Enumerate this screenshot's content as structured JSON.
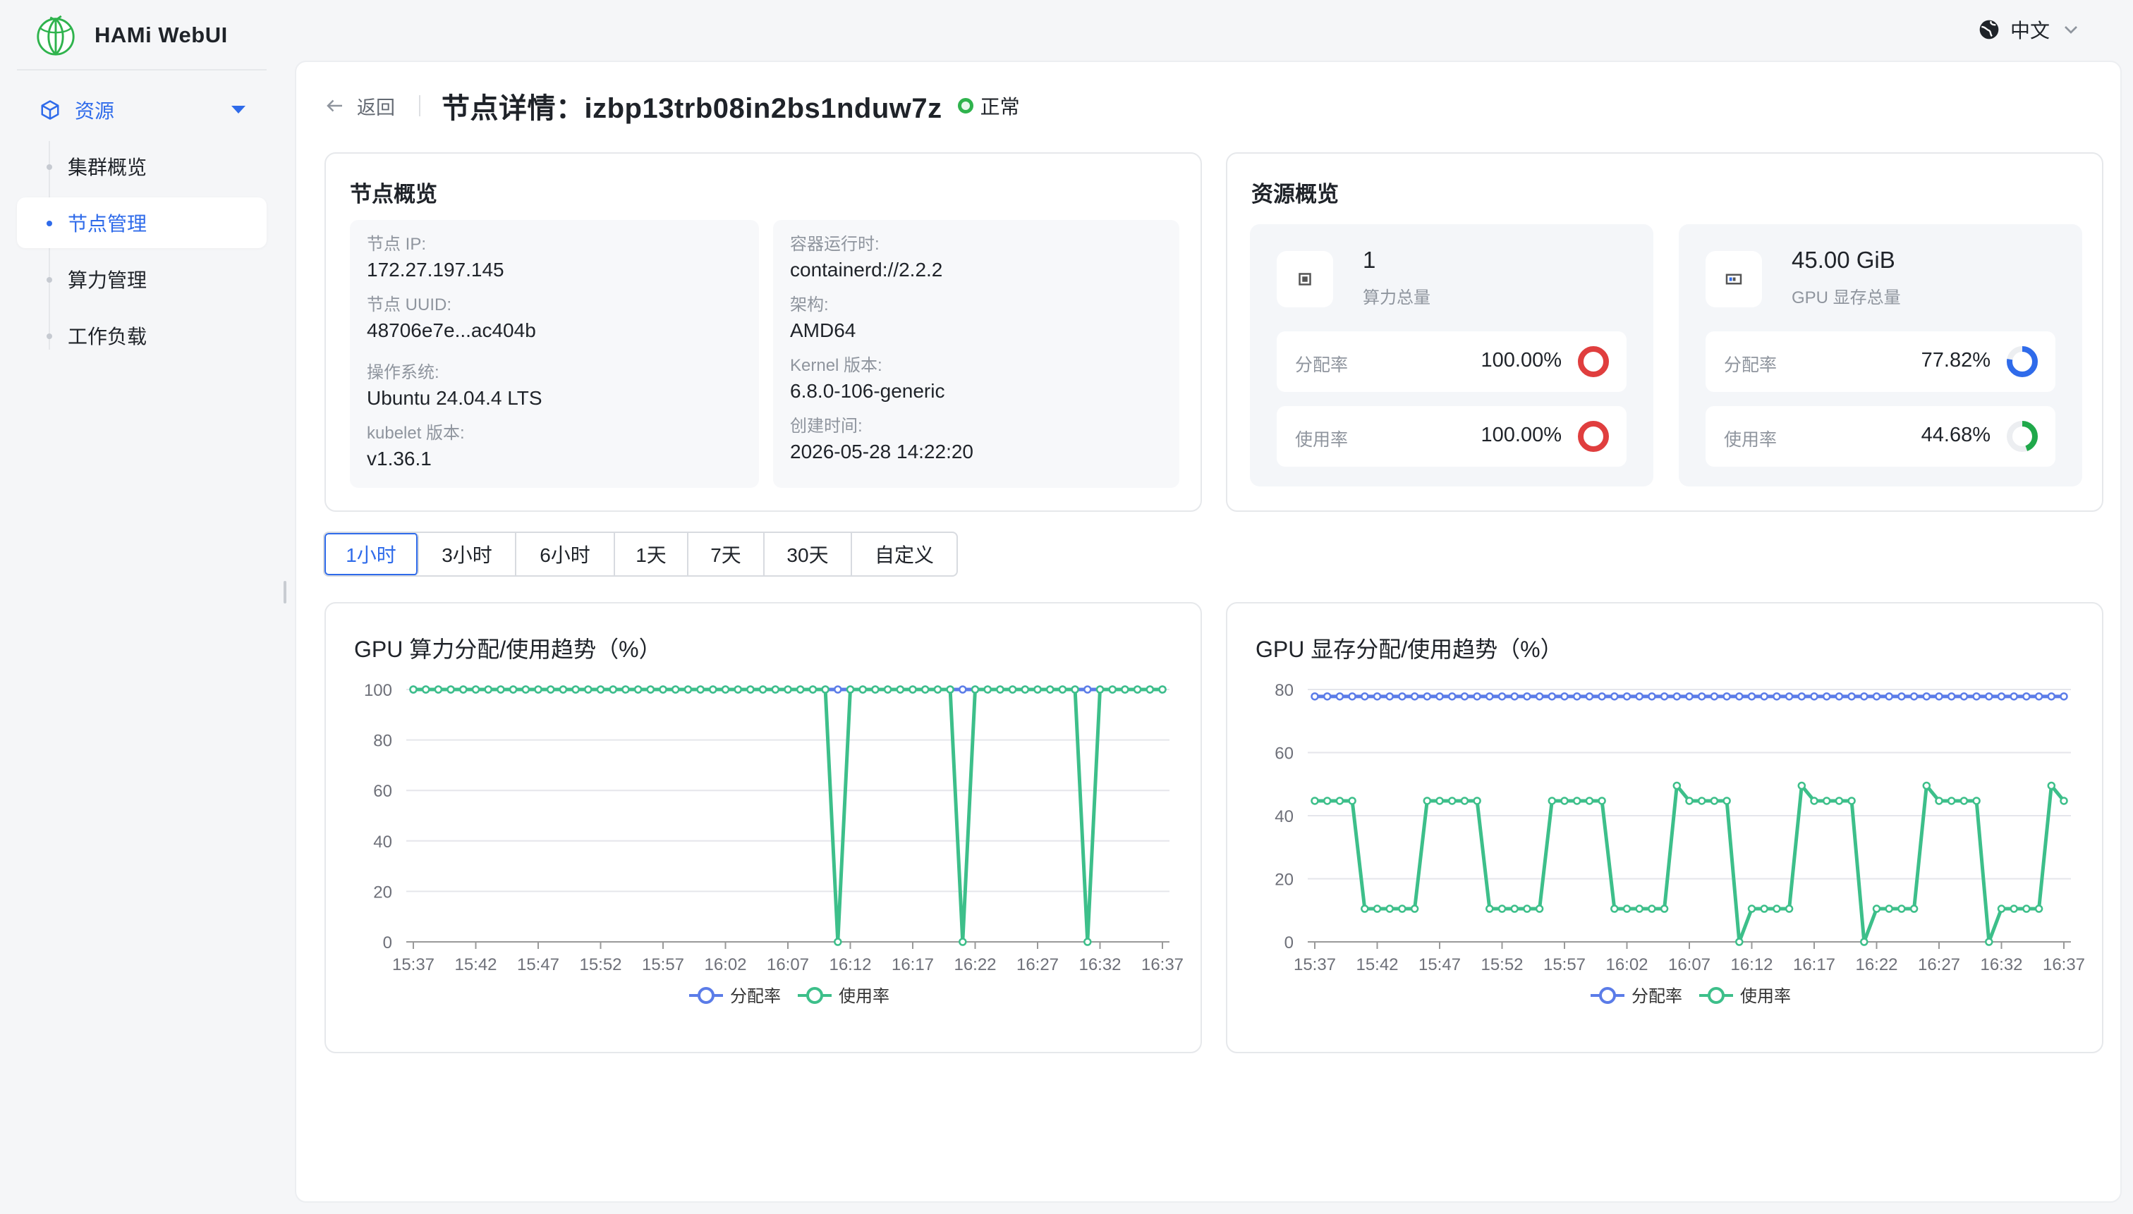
{
  "app": {
    "title": "HAMi WebUI"
  },
  "language": {
    "label": "中文"
  },
  "sidebar": {
    "group": {
      "label": "资源"
    },
    "items": [
      {
        "label": "集群概览",
        "active": false
      },
      {
        "label": "节点管理",
        "active": true
      },
      {
        "label": "算力管理",
        "active": false
      },
      {
        "label": "工作负载",
        "active": false
      }
    ]
  },
  "header": {
    "back_label": "返回",
    "title": "节点详情：izbp13trb08in2bs1nduw7z",
    "status": "正常"
  },
  "node_overview": {
    "title": "节点概览",
    "left": [
      {
        "label": "节点 IP:",
        "value": "172.27.197.145"
      },
      {
        "label": "节点 UUID:",
        "value": "48706e7e...ac404b"
      },
      {
        "label": "操作系统:",
        "value": "Ubuntu 24.04.4 LTS"
      },
      {
        "label": "kubelet 版本:",
        "value": "v1.36.1"
      }
    ],
    "right": [
      {
        "label": "容器运行时:",
        "value": "containerd://2.2.2"
      },
      {
        "label": "架构:",
        "value": "AMD64"
      },
      {
        "label": "Kernel 版本:",
        "value": "6.8.0-106-generic"
      },
      {
        "label": "创建时间:",
        "value": "2026-05-28 14:22:20"
      }
    ]
  },
  "resource_overview": {
    "title": "资源概览",
    "compute": {
      "value": "1",
      "caption": "算力总量",
      "icon": "chip-icon",
      "alloc_label": "分配率",
      "alloc_value": "100.00%",
      "alloc_fraction": 1.0,
      "usage_label": "使用率",
      "usage_value": "100.00%",
      "usage_fraction": 1.0,
      "color": "#e03e3e"
    },
    "memory": {
      "value": "45.00 GiB",
      "caption": "GPU 显存总量",
      "icon": "memory-icon",
      "alloc_label": "分配率",
      "alloc_value": "77.82%",
      "alloc_fraction": 0.7782,
      "alloc_color": "#2f6bea",
      "usage_label": "使用率",
      "usage_value": "44.68%",
      "usage_fraction": 0.4468,
      "usage_color": "#1fa84a"
    }
  },
  "time_ranges": {
    "options": [
      "1小时",
      "3小时",
      "6小时",
      "1天",
      "7天",
      "30天",
      "自定义"
    ],
    "selected": "1小时"
  },
  "charts": {
    "colors": {
      "alloc": "#5b7ce8",
      "usage": "#3dbf8a"
    },
    "legend": {
      "alloc": "分配率",
      "usage": "使用率"
    },
    "compute": {
      "title": "GPU 算力分配/使用趋势（%）"
    },
    "memory": {
      "title": "GPU 显存分配/使用趋势（%）"
    }
  },
  "chart_data": [
    {
      "type": "line",
      "title": "GPU 算力分配/使用趋势（%）",
      "x_ticks": [
        "15:37",
        "15:42",
        "15:47",
        "15:52",
        "15:57",
        "16:02",
        "16:07",
        "16:12",
        "16:17",
        "16:22",
        "16:27",
        "16:32",
        "16:37"
      ],
      "ylim": [
        0,
        100
      ],
      "y_ticks": [
        0,
        20,
        40,
        60,
        80,
        100
      ],
      "grid": true,
      "legend_position": "bottom",
      "series": [
        {
          "name": "分配率",
          "values": [
            100,
            100,
            100,
            100,
            100,
            100,
            100,
            100,
            100,
            100,
            100,
            100,
            100,
            100,
            100,
            100,
            100,
            100,
            100,
            100,
            100,
            100,
            100,
            100,
            100,
            100,
            100,
            100,
            100,
            100,
            100,
            100,
            100,
            100,
            100,
            100,
            100,
            100,
            100,
            100,
            100,
            100,
            100,
            100,
            100,
            100,
            100,
            100,
            100,
            100,
            100,
            100,
            100,
            100,
            100,
            100,
            100,
            100,
            100,
            100,
            100
          ]
        },
        {
          "name": "使用率",
          "values": [
            100,
            100,
            100,
            100,
            100,
            100,
            100,
            100,
            100,
            100,
            100,
            100,
            100,
            100,
            100,
            100,
            100,
            100,
            100,
            100,
            100,
            100,
            100,
            100,
            100,
            100,
            100,
            100,
            100,
            100,
            100,
            100,
            100,
            100,
            0,
            100,
            100,
            100,
            100,
            100,
            100,
            100,
            100,
            100,
            0,
            100,
            100,
            100,
            100,
            100,
            100,
            100,
            100,
            100,
            0,
            100,
            100,
            100,
            100,
            100,
            100
          ]
        }
      ]
    },
    {
      "type": "line",
      "title": "GPU 显存分配/使用趋势（%）",
      "x_ticks": [
        "15:37",
        "15:42",
        "15:47",
        "15:52",
        "15:57",
        "16:02",
        "16:07",
        "16:12",
        "16:17",
        "16:22",
        "16:27",
        "16:32",
        "16:37"
      ],
      "ylim": [
        0,
        80
      ],
      "y_ticks": [
        0,
        20,
        40,
        60,
        80
      ],
      "grid": true,
      "legend_position": "bottom",
      "series": [
        {
          "name": "分配率",
          "values": [
            77.8,
            77.8,
            77.8,
            77.8,
            77.8,
            77.8,
            77.8,
            77.8,
            77.8,
            77.8,
            77.8,
            77.8,
            77.8,
            77.8,
            77.8,
            77.8,
            77.8,
            77.8,
            77.8,
            77.8,
            77.8,
            77.8,
            77.8,
            77.8,
            77.8,
            77.8,
            77.8,
            77.8,
            77.8,
            77.8,
            77.8,
            77.8,
            77.8,
            77.8,
            77.8,
            77.8,
            77.8,
            77.8,
            77.8,
            77.8,
            77.8,
            77.8,
            77.8,
            77.8,
            77.8,
            77.8,
            77.8,
            77.8,
            77.8,
            77.8,
            77.8,
            77.8,
            77.8,
            77.8,
            77.8,
            77.8,
            77.8,
            77.8,
            77.8,
            77.8,
            77.8
          ]
        },
        {
          "name": "使用率",
          "values": [
            44.7,
            44.7,
            44.7,
            44.7,
            10.5,
            10.5,
            10.5,
            10.5,
            10.5,
            44.7,
            44.7,
            44.7,
            44.7,
            44.7,
            10.5,
            10.5,
            10.5,
            10.5,
            10.5,
            44.7,
            44.7,
            44.7,
            44.7,
            44.7,
            10.5,
            10.5,
            10.5,
            10.5,
            10.5,
            49.5,
            44.7,
            44.7,
            44.7,
            44.7,
            0,
            10.5,
            10.5,
            10.5,
            10.5,
            49.5,
            44.7,
            44.7,
            44.7,
            44.7,
            0,
            10.5,
            10.5,
            10.5,
            10.5,
            49.5,
            44.7,
            44.7,
            44.7,
            44.7,
            0,
            10.5,
            10.5,
            10.5,
            10.5,
            49.5,
            44.7
          ]
        }
      ]
    }
  ]
}
